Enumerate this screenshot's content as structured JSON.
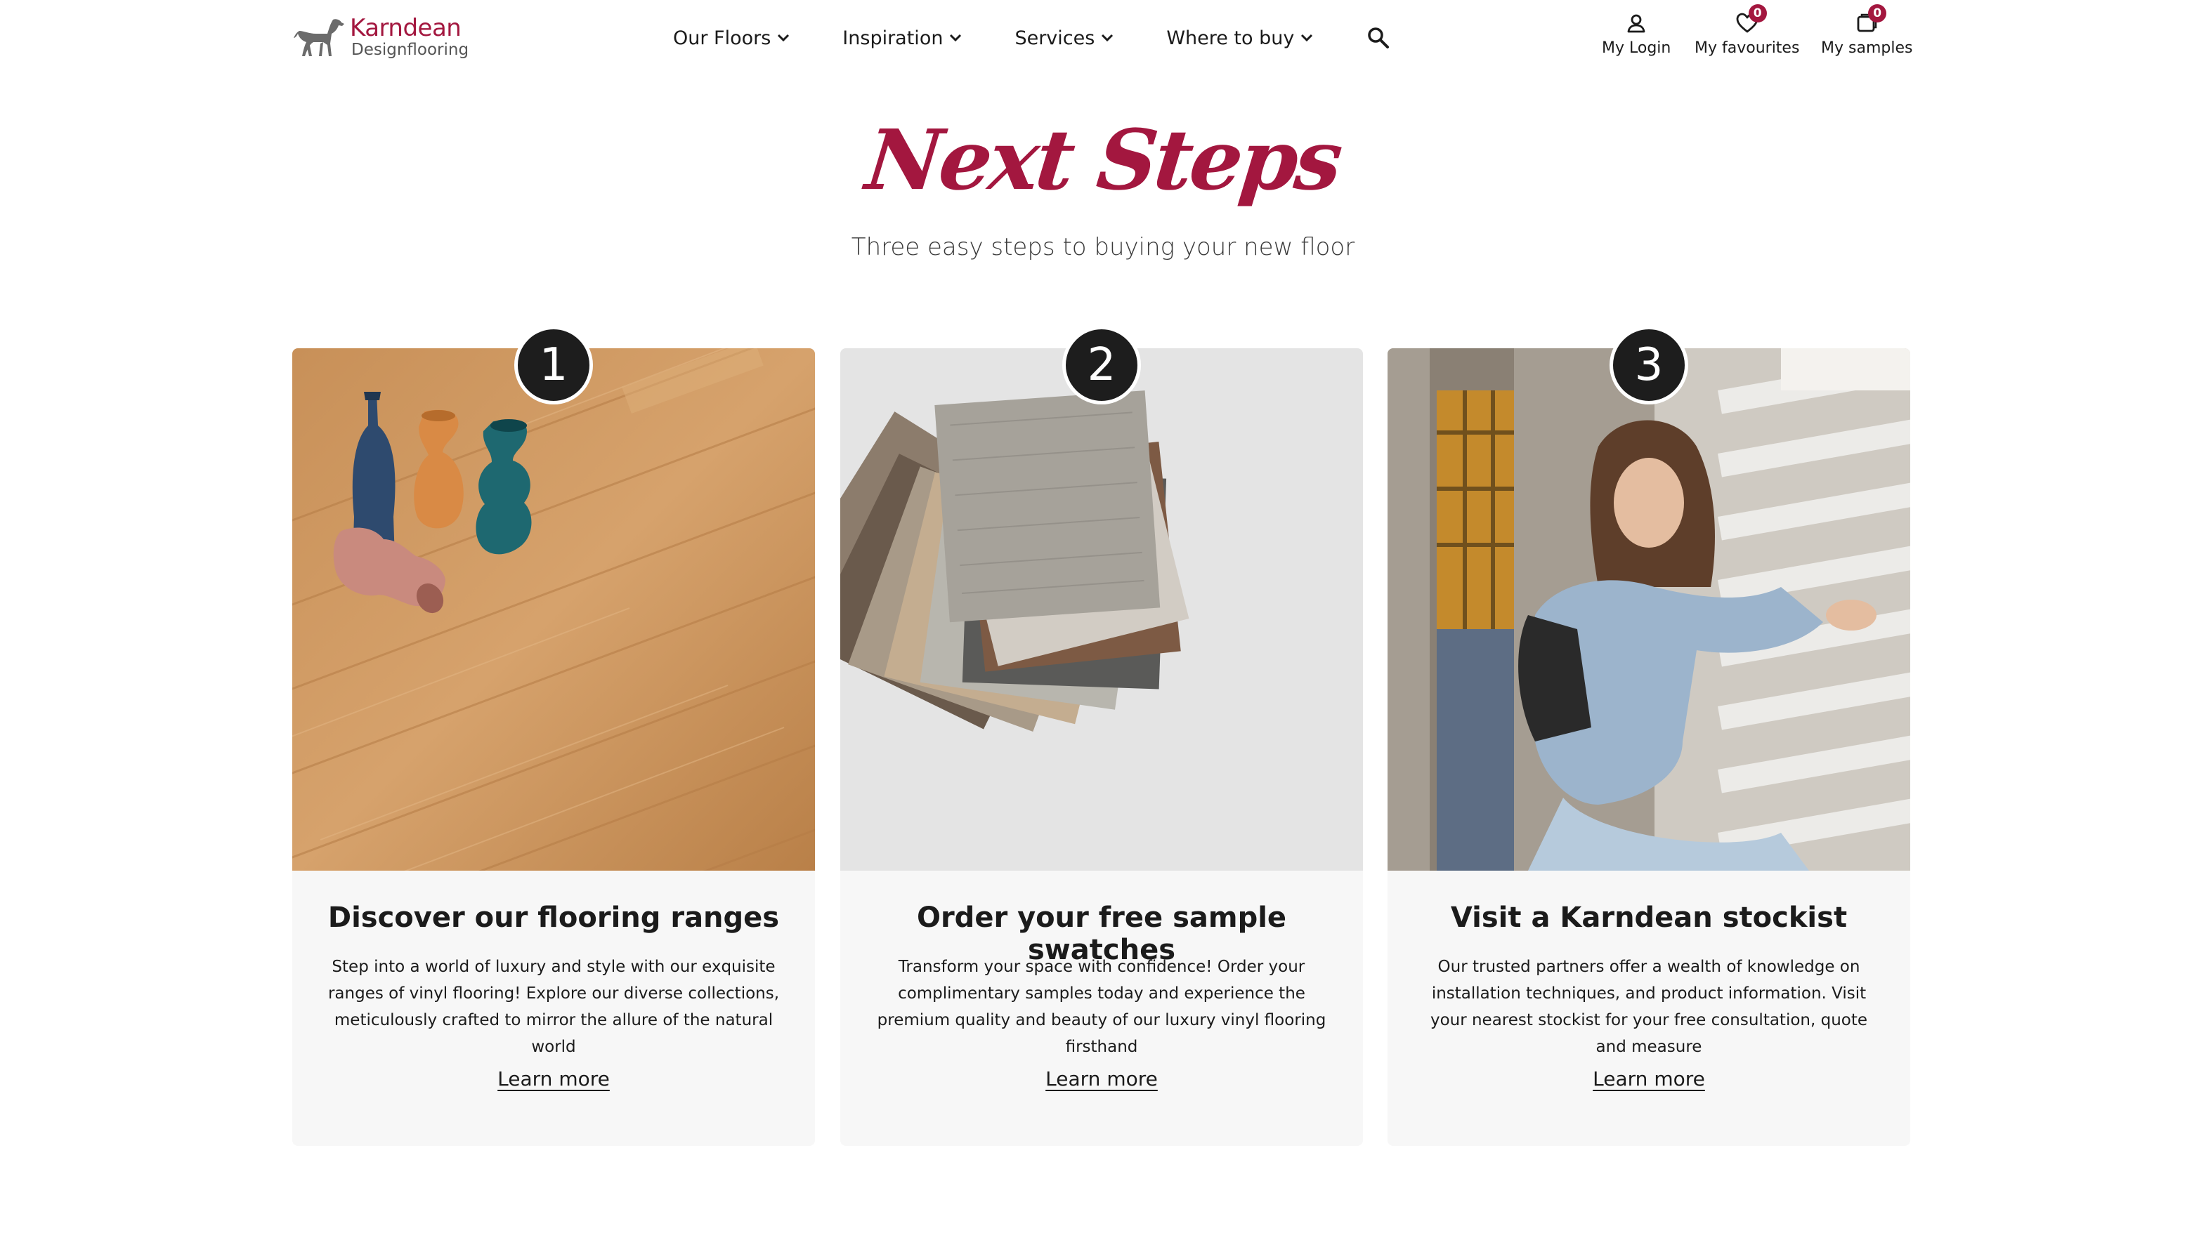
{
  "brand": {
    "name": "Karndean",
    "tagline": "Designflooring",
    "accent_color": "#a3173f"
  },
  "nav": {
    "items": [
      {
        "label": "Our Floors",
        "icon": "chevron-down-icon"
      },
      {
        "label": "Inspiration",
        "icon": "chevron-down-icon"
      },
      {
        "label": "Services",
        "icon": "chevron-down-icon"
      },
      {
        "label": "Where to buy",
        "icon": "chevron-down-icon"
      }
    ],
    "search_icon": "search-icon"
  },
  "utility": {
    "login_label": "My Login",
    "favourites_label": "My favourites",
    "favourites_count": "0",
    "samples_label": "My samples",
    "samples_count": "0"
  },
  "hero": {
    "title": "Next Steps",
    "subtitle": "Three easy steps to buying your new floor"
  },
  "steps": [
    {
      "number": "1",
      "title": "Discover our flooring ranges",
      "text": "Step into a world of luxury and style with our exquisite ranges of vinyl flooring! Explore our diverse collections, meticulously crafted to mirror the allure of the natural world",
      "link": "Learn more"
    },
    {
      "number": "2",
      "title": "Order your free sample swatches",
      "text": "Transform your space with confidence! Order your complimentary samples today and experience the premium quality and beauty of our luxury vinyl flooring firsthand",
      "link": "Learn more"
    },
    {
      "number": "3",
      "title": "Visit a Karndean stockist",
      "text": "Our trusted partners offer a wealth of knowledge on installation techniques, and product information. Visit your nearest stockist for your free consultation, quote and measure",
      "link": "Learn more"
    }
  ]
}
